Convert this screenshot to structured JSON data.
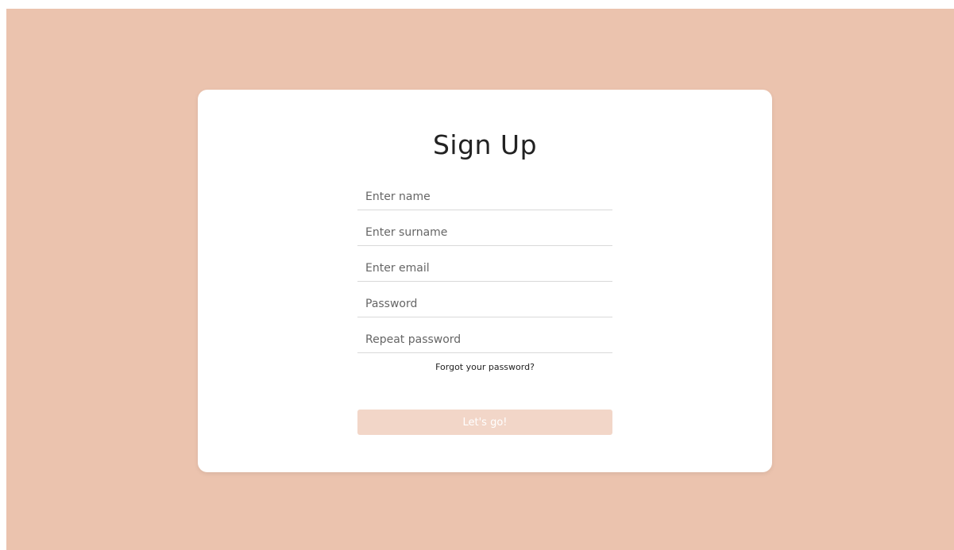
{
  "form": {
    "title": "Sign Up",
    "fields": [
      {
        "placeholder": "Enter name",
        "value": ""
      },
      {
        "placeholder": "Enter surname",
        "value": ""
      },
      {
        "placeholder": "Enter email",
        "value": ""
      },
      {
        "placeholder": "Password",
        "value": ""
      },
      {
        "placeholder": "Repeat password",
        "value": ""
      }
    ],
    "forgot_link": "Forgot your password?",
    "submit_label": "Let's go!"
  },
  "colors": {
    "background": "#ebc3ae",
    "card": "#ffffff",
    "button": "#f2d6c8"
  }
}
